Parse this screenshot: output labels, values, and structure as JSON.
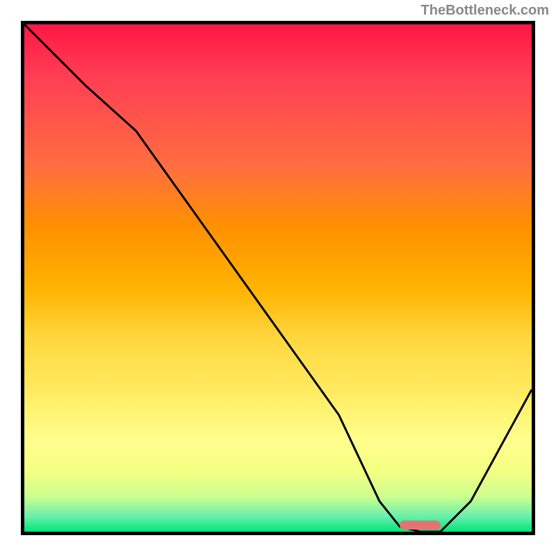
{
  "watermark": "TheBottleneck.com",
  "chart_data": {
    "type": "line",
    "title": "",
    "xlabel": "",
    "ylabel": "",
    "xlim": [
      0,
      100
    ],
    "ylim": [
      0,
      100
    ],
    "series": [
      {
        "name": "bottleneck-curve",
        "x": [
          0,
          12,
          22,
          32,
          42,
          52,
          62,
          70,
          74,
          78,
          82,
          88,
          94,
          100
        ],
        "values": [
          100,
          88,
          79,
          65,
          51,
          37,
          23,
          6,
          1,
          0,
          0,
          6,
          17,
          28
        ]
      }
    ],
    "marker": {
      "x_start": 74,
      "x_end": 82,
      "y": 0
    },
    "gradient": {
      "top_color": "#ff1744",
      "mid_color": "#ffd740",
      "bottom_color": "#00e676"
    }
  }
}
